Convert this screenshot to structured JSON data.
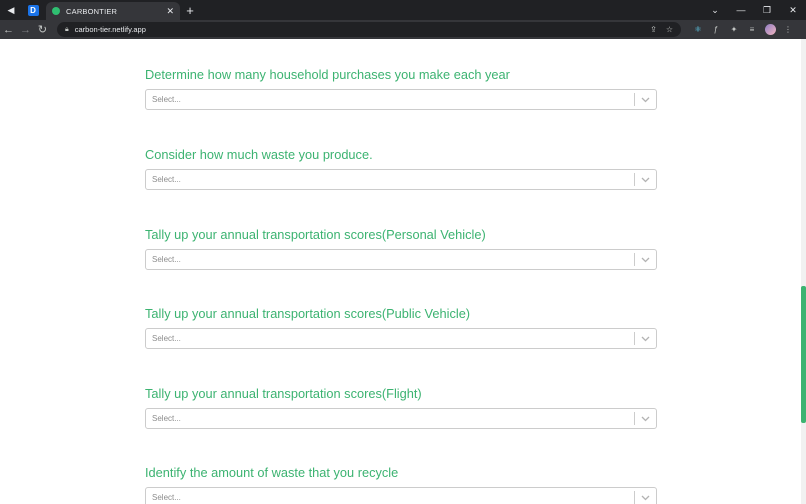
{
  "browser": {
    "pinned_tab_letter": "D",
    "active_tab_title": "CARBONTIER",
    "url": "carbon-tier.netlify.app",
    "accent_color": "#3cb371"
  },
  "form": {
    "questions": [
      {
        "label": "Determine how many household purchases you make each year",
        "placeholder": "Select..."
      },
      {
        "label": "Consider how much waste you produce.",
        "placeholder": "Select..."
      },
      {
        "label": "Tally up your annual transportation scores(Personal Vehicle)",
        "placeholder": "Select..."
      },
      {
        "label": "Tally up your annual transportation scores(Public Vehicle)",
        "placeholder": "Select..."
      },
      {
        "label": "Tally up your annual transportation scores(Flight)",
        "placeholder": "Select..."
      },
      {
        "label": "Identify the amount of waste that you recycle",
        "placeholder": "Select..."
      }
    ]
  }
}
